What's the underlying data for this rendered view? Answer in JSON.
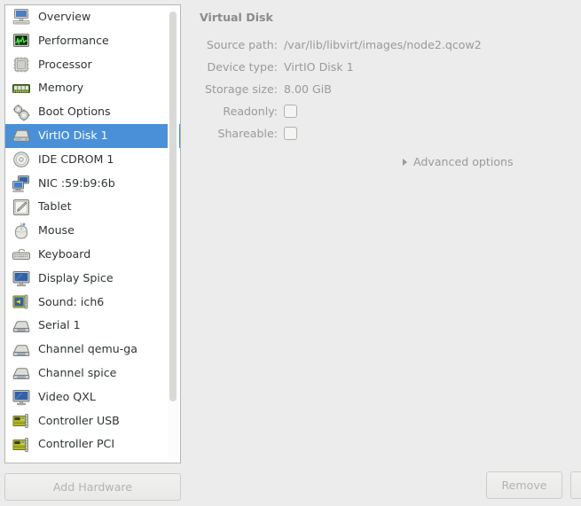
{
  "window": {
    "accent_color": "#4a90d9",
    "background_color": "#ececec",
    "list_background": "#ffffff"
  },
  "hardware_list": {
    "name": "hardware-list",
    "selected_index": 5,
    "items": [
      {
        "label": "Overview",
        "icon": "computer-icon"
      },
      {
        "label": "Performance",
        "icon": "performance-graph-icon"
      },
      {
        "label": "Processor",
        "icon": "cpu-chip-icon"
      },
      {
        "label": "Memory",
        "icon": "memory-module-icon"
      },
      {
        "label": "Boot Options",
        "icon": "gears-icon"
      },
      {
        "label": "VirtIO Disk 1",
        "icon": "hard-disk-icon"
      },
      {
        "label": "IDE CDROM 1",
        "icon": "optical-disc-icon"
      },
      {
        "label": "NIC :59:b9:6b",
        "icon": "network-card-icon"
      },
      {
        "label": "Tablet",
        "icon": "tablet-pen-icon"
      },
      {
        "label": "Mouse",
        "icon": "mouse-icon"
      },
      {
        "label": "Keyboard",
        "icon": "keyboard-icon"
      },
      {
        "label": "Display Spice",
        "icon": "monitor-icon"
      },
      {
        "label": "Sound: ich6",
        "icon": "sound-card-icon"
      },
      {
        "label": "Serial 1",
        "icon": "serial-port-icon"
      },
      {
        "label": "Channel qemu-ga",
        "icon": "serial-port-icon"
      },
      {
        "label": "Channel spice",
        "icon": "serial-port-icon"
      },
      {
        "label": "Video QXL",
        "icon": "monitor-icon"
      },
      {
        "label": "Controller USB",
        "icon": "pci-controller-icon"
      },
      {
        "label": "Controller PCI",
        "icon": "pci-controller-icon"
      }
    ]
  },
  "add_hardware_button": {
    "label": "Add Hardware"
  },
  "details": {
    "title": "Virtual Disk",
    "fields": [
      {
        "label": "Source path:",
        "value": "/var/lib/libvirt/images/node2.qcow2",
        "type": "text"
      },
      {
        "label": "Device type:",
        "value": "VirtIO Disk 1",
        "type": "text"
      },
      {
        "label": "Storage size:",
        "value": "8.00 GiB",
        "type": "text"
      },
      {
        "label": "Readonly:",
        "value": "",
        "type": "checkbox",
        "checked": false
      },
      {
        "label": "Shareable:",
        "value": "",
        "type": "checkbox",
        "checked": false
      }
    ],
    "advanced_options": {
      "label": "Advanced options",
      "expanded": false
    }
  },
  "footer": {
    "remove_label": "Remove",
    "clipped_button_label": ""
  }
}
